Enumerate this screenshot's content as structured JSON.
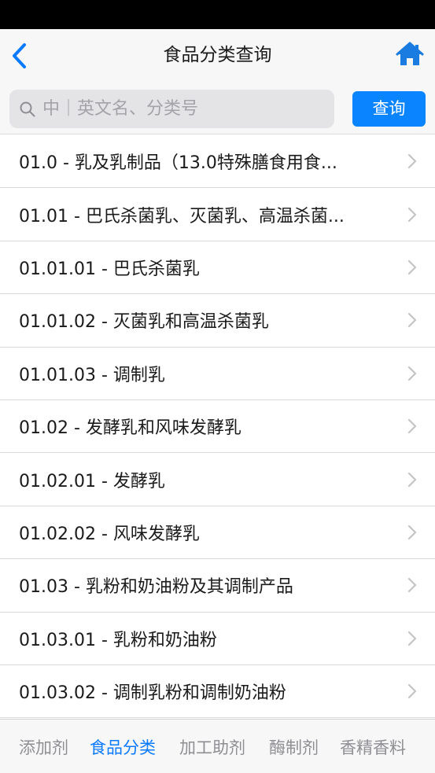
{
  "nav": {
    "title": "食品分类查询"
  },
  "search": {
    "placeholder": "中｜英文名、分类号",
    "value": "",
    "button_label": "查询"
  },
  "categories": [
    {
      "label": "01.0 - 乳及乳制品（13.0特殊膳食用食..."
    },
    {
      "label": "01.01 - 巴氏杀菌乳、灭菌乳、高温杀菌..."
    },
    {
      "label": "01.01.01 - 巴氏杀菌乳"
    },
    {
      "label": "01.01.02 - 灭菌乳和高温杀菌乳"
    },
    {
      "label": "01.01.03 - 调制乳"
    },
    {
      "label": "01.02 - 发酵乳和风味发酵乳"
    },
    {
      "label": "01.02.01 - 发酵乳"
    },
    {
      "label": "01.02.02 - 风味发酵乳"
    },
    {
      "label": "01.03 - 乳粉和奶油粉及其调制产品"
    },
    {
      "label": "01.03.01 - 乳粉和奶油粉"
    },
    {
      "label": "01.03.02 - 调制乳粉和调制奶油粉"
    }
  ],
  "tabs": [
    {
      "label": "添加剂",
      "active": false
    },
    {
      "label": "食品分类",
      "active": true
    },
    {
      "label": "加工助剂",
      "active": false
    },
    {
      "label": "酶制剂",
      "active": false
    },
    {
      "label": "香精香料",
      "active": false
    }
  ],
  "colors": {
    "accent": "#0a84ff",
    "tab_active": "#0a7aff",
    "tab_inactive": "#8e8e93"
  },
  "icons": {
    "back": "chevron-left-icon",
    "home": "home-icon",
    "search": "search-icon",
    "row_disclosure": "chevron-right-icon"
  }
}
